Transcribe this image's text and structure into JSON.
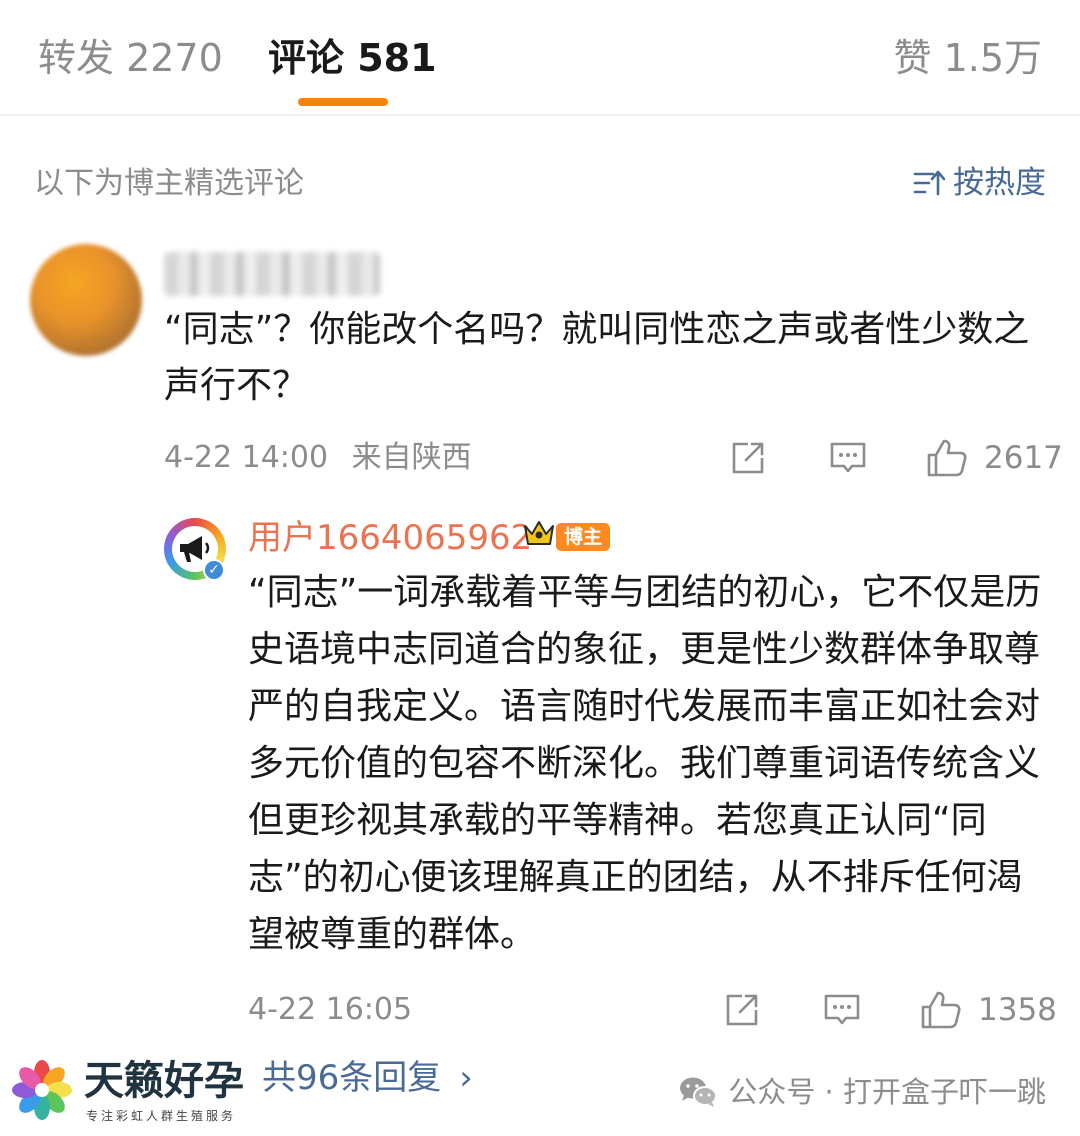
{
  "tabs": {
    "repost": "转发 2270",
    "comments": "评论 581",
    "likes": "赞 1.5万",
    "active": "comments",
    "accent_color": "#ff8200"
  },
  "section": {
    "label": "以下为博主精选评论",
    "sort": "按热度",
    "sort_icon": "sort-icon"
  },
  "comment": {
    "text": "“同志”？你能改个名吗？就叫同性恋之声或者性少数之声行不？",
    "time": "4-22 14:00",
    "location": "来自陕西",
    "likes": "2617",
    "icons": [
      "share-icon",
      "comment-icon",
      "like-icon"
    ]
  },
  "reply": {
    "username": "用户1664065962",
    "badge": "博主",
    "text": "“同志”一词承载着平等与团结的初心，它不仅是历史语境中志同道合的象征，更是性少数群体争取尊严的自我定义。语言随时代发展而丰富正如社会对多元价值的包容不断深化。我们尊重词语传统含义但更珍视其承载的平等精神。若您真正认同“同志”的初心便该理解真正的团结，从不排斥任何渴望被尊重的群体。",
    "time": "4-22 16:05",
    "likes": "1358",
    "username_color": "#eb7350"
  },
  "more_replies": "共96条回复",
  "watermark": {
    "brand": "天籁好孕",
    "brand_sub": "专注彩虹人群生殖服务",
    "wechat": "公众号 · 打开盒子吓一跳"
  }
}
